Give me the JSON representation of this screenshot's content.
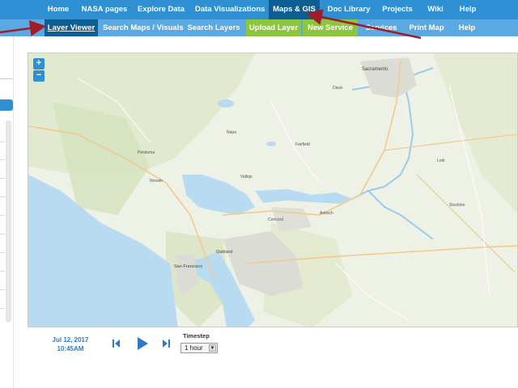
{
  "topnav": {
    "items": [
      "Home",
      "NASA pages",
      "Explore Data",
      "Data Visualizations",
      "Maps & GIS",
      "Doc Library",
      "Projects",
      "Wiki",
      "Help"
    ],
    "active": "Maps & GIS"
  },
  "subnav": {
    "items": [
      "Layer Viewer",
      "Search Maps / Visuals",
      "Search Layers",
      "Upload Layer",
      "New Service",
      "Services",
      "Print Map",
      "Help"
    ],
    "active": "Layer Viewer"
  },
  "map": {
    "zoom_in": "+",
    "zoom_out": "−",
    "place_labels": [
      "Sacramento",
      "San Francisco",
      "Oakland",
      "Petaluma",
      "Novato",
      "Vallejo",
      "Fairfield",
      "Davis",
      "Lodi",
      "Stockton",
      "Concord",
      "Antioch",
      "Napa"
    ]
  },
  "timeline": {
    "date": "Jul 12, 2017",
    "time": "10:45AM",
    "timestep_label": "Timestep",
    "timestep_value": "1 hour"
  },
  "colors": {
    "nav_blue": "#2e8fd3",
    "nav_active": "#0d5e94",
    "subnav_blue": "#5aa9e2",
    "upload_green": "#8cc63e",
    "annotation_arrow": "#a01c2a"
  }
}
